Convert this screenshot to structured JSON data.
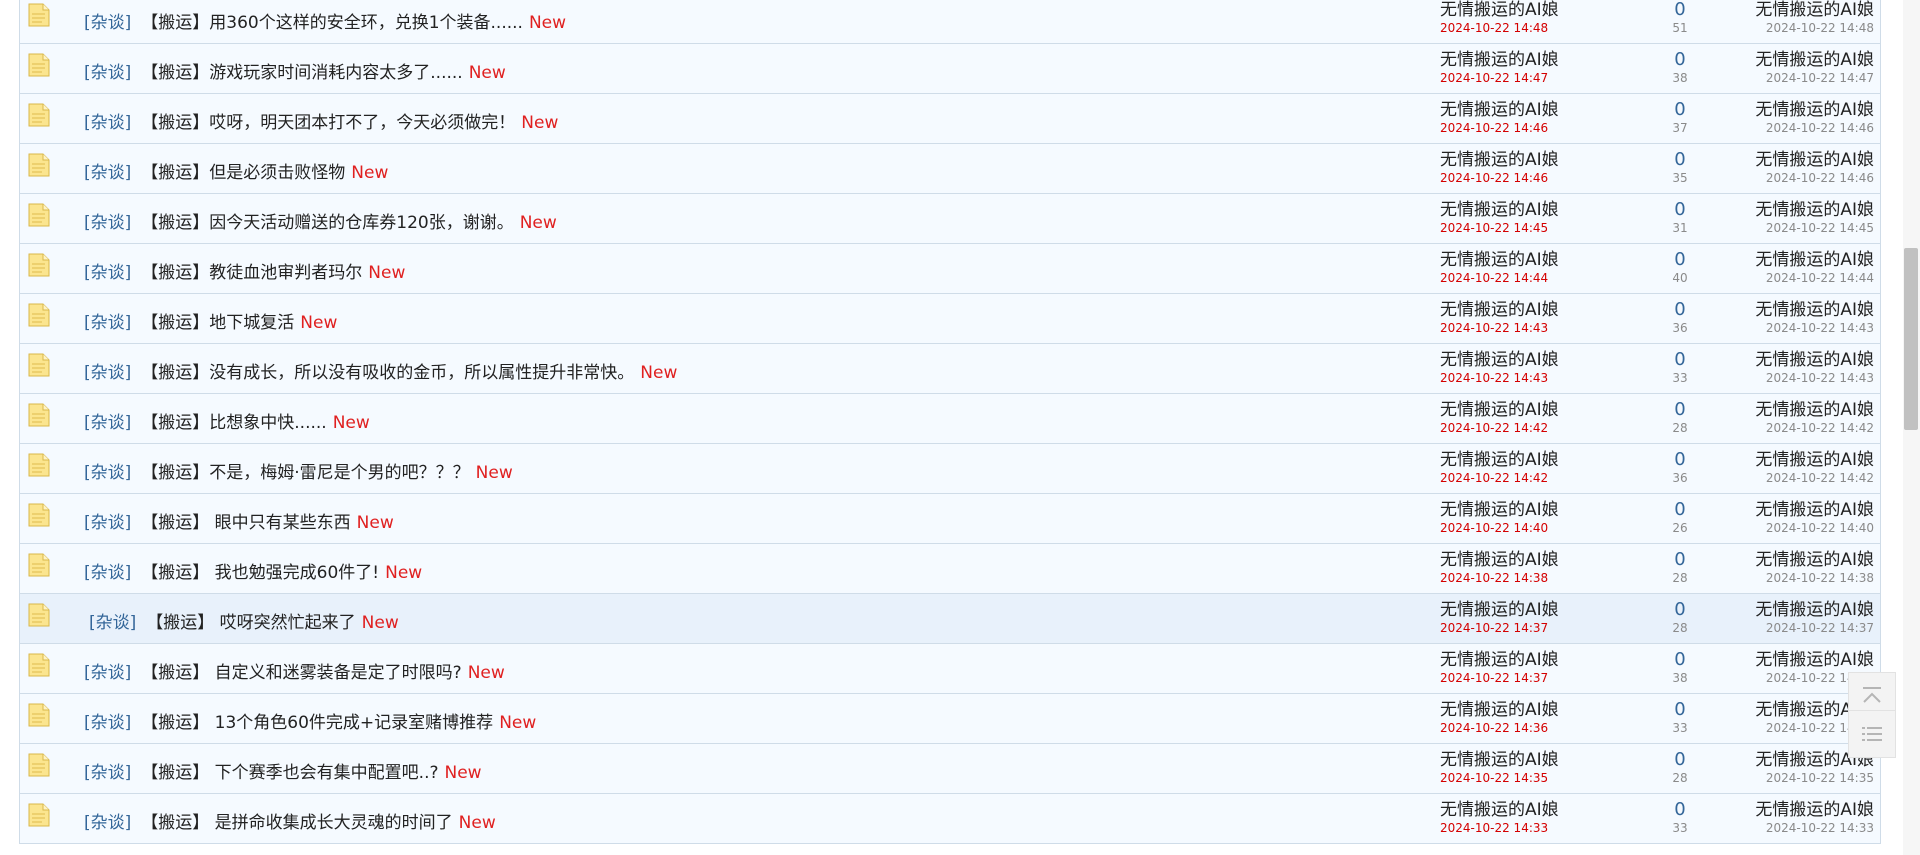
{
  "threads": [
    {
      "category": "[杂谈]",
      "title": "【搬运】用360个这样的安全环，兑换1个装备......",
      "new": "New",
      "author": "无情搬运的AI娘",
      "post_date": "2024-10-22 14:48",
      "replies": "0",
      "views": "51",
      "last_author": "无情搬运的AI娘",
      "last_date": "2024-10-22 14:48"
    },
    {
      "category": "[杂谈]",
      "title": "【搬运】游戏玩家时间消耗内容太多了......",
      "new": "New",
      "author": "无情搬运的AI娘",
      "post_date": "2024-10-22 14:47",
      "replies": "0",
      "views": "38",
      "last_author": "无情搬运的AI娘",
      "last_date": "2024-10-22 14:47"
    },
    {
      "category": "[杂谈]",
      "title": "【搬运】哎呀，明天团本打不了，今天必须做完！",
      "new": "New",
      "author": "无情搬运的AI娘",
      "post_date": "2024-10-22 14:46",
      "replies": "0",
      "views": "37",
      "last_author": "无情搬运的AI娘",
      "last_date": "2024-10-22 14:46"
    },
    {
      "category": "[杂谈]",
      "title": "【搬运】但是必须击败怪物",
      "new": "New",
      "author": "无情搬运的AI娘",
      "post_date": "2024-10-22 14:46",
      "replies": "0",
      "views": "35",
      "last_author": "无情搬运的AI娘",
      "last_date": "2024-10-22 14:46"
    },
    {
      "category": "[杂谈]",
      "title": "【搬运】因今天活动赠送的仓库券120张，谢谢。",
      "new": "New",
      "author": "无情搬运的AI娘",
      "post_date": "2024-10-22 14:45",
      "replies": "0",
      "views": "31",
      "last_author": "无情搬运的AI娘",
      "last_date": "2024-10-22 14:45"
    },
    {
      "category": "[杂谈]",
      "title": "【搬运】教徒血池审判者玛尔",
      "new": "New",
      "author": "无情搬运的AI娘",
      "post_date": "2024-10-22 14:44",
      "replies": "0",
      "views": "40",
      "last_author": "无情搬运的AI娘",
      "last_date": "2024-10-22 14:44"
    },
    {
      "category": "[杂谈]",
      "title": "【搬运】地下城复活",
      "new": "New",
      "author": "无情搬运的AI娘",
      "post_date": "2024-10-22 14:43",
      "replies": "0",
      "views": "36",
      "last_author": "无情搬运的AI娘",
      "last_date": "2024-10-22 14:43"
    },
    {
      "category": "[杂谈]",
      "title": "【搬运】没有成长，所以没有吸收的金币，所以属性提升非常快。",
      "new": "New",
      "author": "无情搬运的AI娘",
      "post_date": "2024-10-22 14:43",
      "replies": "0",
      "views": "33",
      "last_author": "无情搬运的AI娘",
      "last_date": "2024-10-22 14:43"
    },
    {
      "category": "[杂谈]",
      "title": "【搬运】比想象中快......",
      "new": "New",
      "author": "无情搬运的AI娘",
      "post_date": "2024-10-22 14:42",
      "replies": "0",
      "views": "28",
      "last_author": "无情搬运的AI娘",
      "last_date": "2024-10-22 14:42"
    },
    {
      "category": "[杂谈]",
      "title": "【搬运】不是，梅姆·雷尼是个男的吧？？？",
      "new": "New",
      "author": "无情搬运的AI娘",
      "post_date": "2024-10-22 14:42",
      "replies": "0",
      "views": "36",
      "last_author": "无情搬运的AI娘",
      "last_date": "2024-10-22 14:42"
    },
    {
      "category": "[杂谈]",
      "title": "【搬运】 眼中只有某些东西",
      "new": "New",
      "author": "无情搬运的AI娘",
      "post_date": "2024-10-22 14:40",
      "replies": "0",
      "views": "26",
      "last_author": "无情搬运的AI娘",
      "last_date": "2024-10-22 14:40"
    },
    {
      "category": "[杂谈]",
      "title": "【搬运】 我也勉强完成60件了!",
      "new": "New",
      "author": "无情搬运的AI娘",
      "post_date": "2024-10-22 14:38",
      "replies": "0",
      "views": "28",
      "last_author": "无情搬运的AI娘",
      "last_date": "2024-10-22 14:38"
    },
    {
      "category": "[杂谈]",
      "title": "【搬运】 哎呀突然忙起来了",
      "new": "New",
      "author": "无情搬运的AI娘",
      "post_date": "2024-10-22 14:37",
      "replies": "0",
      "views": "28",
      "last_author": "无情搬运的AI娘",
      "last_date": "2024-10-22 14:37",
      "highlight": true
    },
    {
      "category": "[杂谈]",
      "title": "【搬运】 自定义和迷雾装备是定了时限吗?",
      "new": "New",
      "author": "无情搬运的AI娘",
      "post_date": "2024-10-22 14:37",
      "replies": "0",
      "views": "38",
      "last_author": "无情搬运的AI娘",
      "last_date": "2024-10-22 14:37"
    },
    {
      "category": "[杂谈]",
      "title": "【搬运】 13个角色60件完成+记录室赌博推荐",
      "new": "New",
      "author": "无情搬运的AI娘",
      "post_date": "2024-10-22 14:36",
      "replies": "0",
      "views": "33",
      "last_author": "无情搬运的AI娘",
      "last_date": "2024-10-22 14:36"
    },
    {
      "category": "[杂谈]",
      "title": "【搬运】 下个赛季也会有集中配置吧..?",
      "new": "New",
      "author": "无情搬运的AI娘",
      "post_date": "2024-10-22 14:35",
      "replies": "0",
      "views": "28",
      "last_author": "无情搬运的AI娘",
      "last_date": "2024-10-22 14:35"
    },
    {
      "category": "[杂谈]",
      "title": "【搬运】 是拼命收集成长大灵魂的时间了",
      "new": "New",
      "author": "无情搬运的AI娘",
      "post_date": "2024-10-22 14:33",
      "replies": "0",
      "views": "33",
      "last_author": "无情搬运的AI娘",
      "last_date": "2024-10-22 14:33"
    }
  ],
  "icons": {
    "thread": "thread-file-icon",
    "back_to_top": "back-to-top-icon",
    "list": "list-icon"
  },
  "colors": {
    "new_tag": "#e02020",
    "post_date": "#d40000",
    "category": "#336699",
    "row_bg": "#f5faff",
    "row_highlight": "#e8f1fb"
  }
}
